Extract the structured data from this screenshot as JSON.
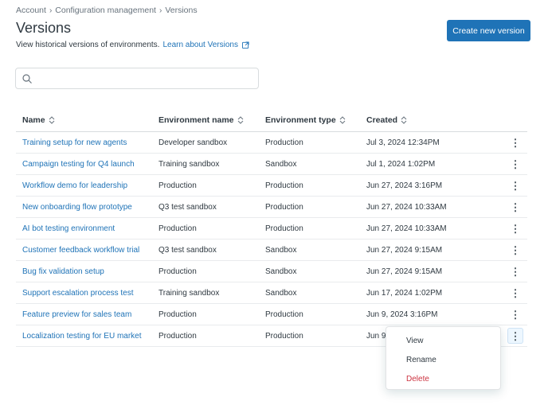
{
  "breadcrumb": [
    "Account",
    "Configuration management",
    "Versions"
  ],
  "page": {
    "title": "Versions",
    "subtitle": "View historical versions of environments.",
    "learn_link": "Learn about Versions",
    "create_button": "Create new version"
  },
  "search": {
    "placeholder": "",
    "value": ""
  },
  "table": {
    "headers": [
      "Name",
      "Environment name",
      "Environment type",
      "Created"
    ],
    "rows": [
      [
        "Training setup for new agents",
        "Developer sandbox",
        "Production",
        "Jul 3, 2024 12:34PM"
      ],
      [
        "Campaign testing for Q4 launch",
        "Training sandbox",
        "Sandbox",
        "Jul 1, 2024 1:02PM"
      ],
      [
        "Workflow demo for leadership",
        "Production",
        "Production",
        "Jun 27, 2024 3:16PM"
      ],
      [
        "New onboarding flow prototype",
        "Q3 test sandbox",
        "Production",
        "Jun 27, 2024 10:33AM"
      ],
      [
        "AI bot testing environment",
        "Production",
        "Production",
        "Jun 27, 2024 10:33AM"
      ],
      [
        "Customer feedback workflow trial",
        "Q3 test sandbox",
        "Sandbox",
        "Jun 27, 2024 9:15AM"
      ],
      [
        "Bug fix validation setup",
        "Production",
        "Sandbox",
        "Jun 27, 2024 9:15AM"
      ],
      [
        "Support escalation process test",
        "Training sandbox",
        "Sandbox",
        "Jun 17, 2024 1:02PM"
      ],
      [
        "Feature preview for sales team",
        "Production",
        "Production",
        "Jun 9, 2024 3:16PM"
      ],
      [
        "Localization testing for EU market",
        "Production",
        "Production",
        "Jun 9"
      ]
    ],
    "row_menu_glyph": "⋮"
  },
  "context_menu": {
    "items": [
      "View",
      "Rename",
      "Delete"
    ]
  },
  "colors": {
    "accent": "#1f73b7",
    "danger": "#cc3340",
    "text": "#2f3941",
    "muted": "#68737d"
  }
}
